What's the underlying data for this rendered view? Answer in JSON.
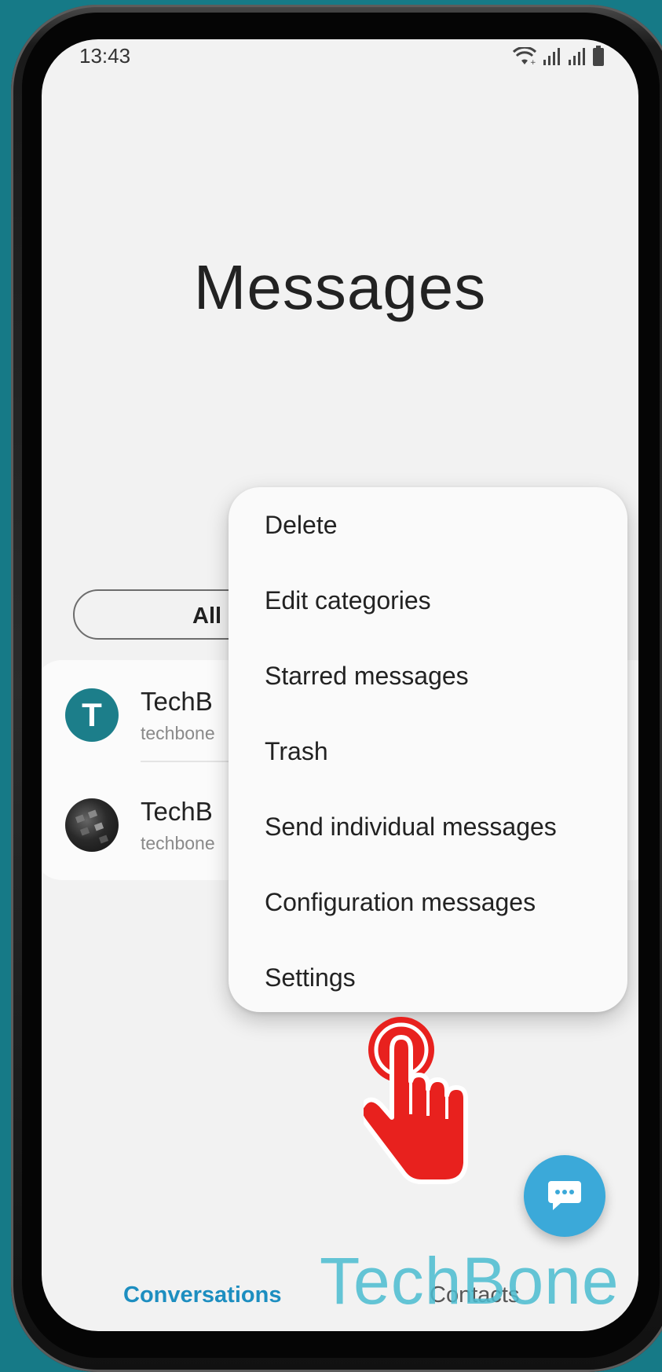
{
  "status_bar": {
    "time": "13:43",
    "icons": [
      "wifi-icon",
      "signal-icon",
      "signal-icon",
      "battery-icon"
    ]
  },
  "app": {
    "title": "Messages"
  },
  "filter": {
    "selected_label": "All"
  },
  "conversations": [
    {
      "name": "TechB",
      "preview": "techbone",
      "avatar_letter": "T"
    },
    {
      "name": "TechB",
      "preview": "techbone",
      "avatar_letter": ""
    }
  ],
  "menu": {
    "items": [
      {
        "label": "Delete"
      },
      {
        "label": "Edit categories"
      },
      {
        "label": "Starred messages"
      },
      {
        "label": "Trash"
      },
      {
        "label": "Send individual messages"
      },
      {
        "label": "Configuration messages"
      },
      {
        "label": "Settings"
      }
    ]
  },
  "compose": {
    "icon": "chat-bubble-icon"
  },
  "bottom_nav": {
    "tabs": [
      {
        "label": "Conversations"
      },
      {
        "label": "Contacts"
      }
    ]
  },
  "watermark": {
    "text": "TechBone"
  },
  "colors": {
    "accent": "#1d8ec0",
    "fab": "#3ba9d9",
    "avatar": "#1c7e8a",
    "tap_indicator": "#e8211e",
    "background": "#167a87"
  }
}
